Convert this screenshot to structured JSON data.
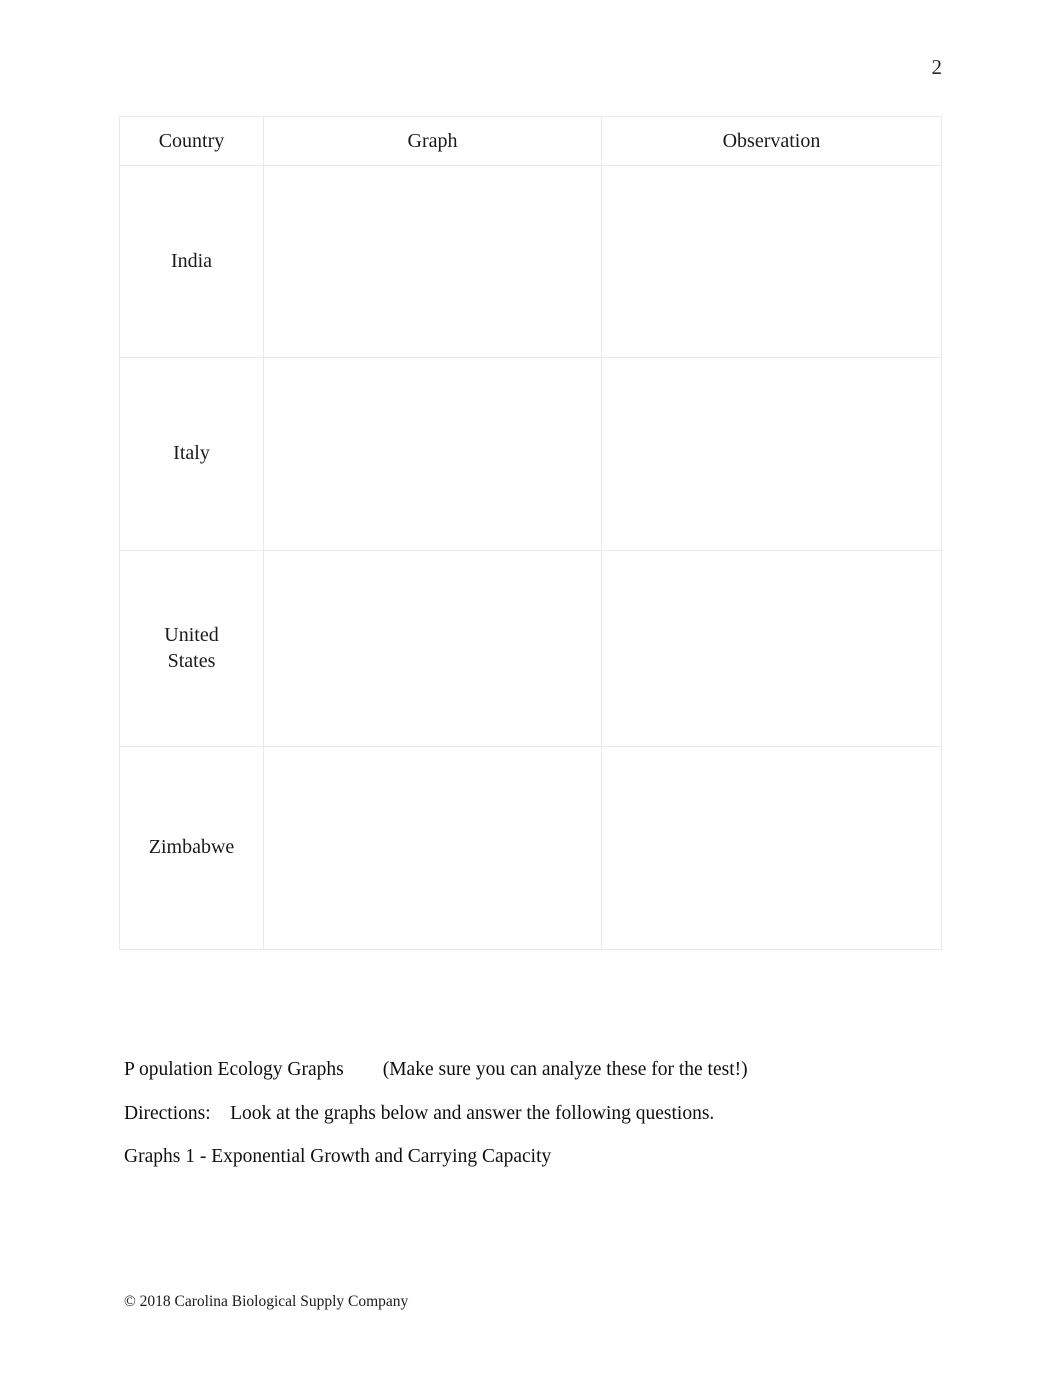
{
  "page": {
    "number": "2"
  },
  "table": {
    "headers": [
      "Country",
      "Graph",
      "Observation"
    ],
    "rows": [
      {
        "country": "India",
        "graph": "",
        "observation": ""
      },
      {
        "country": "Italy",
        "graph": "",
        "observation": ""
      },
      {
        "country": "United\nStates",
        "graph": "",
        "observation": ""
      },
      {
        "country": "Zimbabwe",
        "graph": "",
        "observation": ""
      }
    ]
  },
  "content": {
    "heading": "P opulation Ecology Graphs        (Make sure you can analyze these for the test!)",
    "directions": "Directions:    Look at the graphs below and answer the following questions.",
    "graph_title": "Graphs 1 - Exponential Growth and Carrying Capacity"
  },
  "footer": {
    "copyright": "© 2018 Carolina Biological Supply Company"
  },
  "colors": {
    "page_background": "#ffffff",
    "text": "#000000",
    "table_border": "#eaeaea"
  }
}
